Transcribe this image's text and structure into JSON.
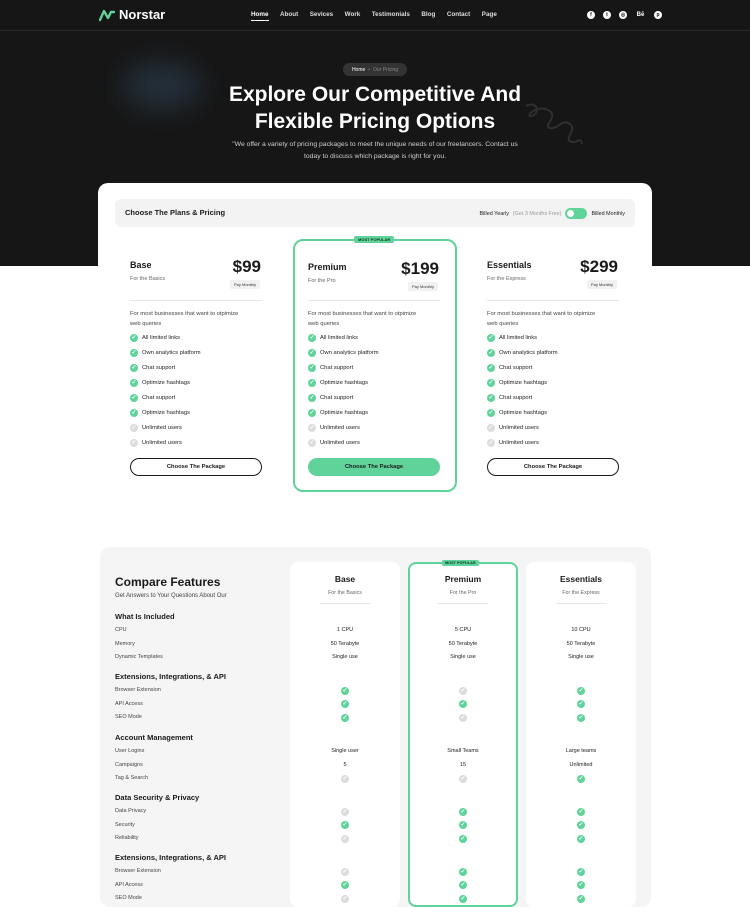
{
  "nav": {
    "brand": "Norstar",
    "items": [
      "Home",
      "About",
      "Sevices",
      "Work",
      "Testimonials",
      "Blog",
      "Contact",
      "Page"
    ],
    "socials": [
      {
        "icon": "facebook-icon",
        "glyph": "f"
      },
      {
        "icon": "twitter-icon",
        "glyph": "t"
      },
      {
        "icon": "dribbble-icon",
        "glyph": "◎"
      },
      {
        "icon": "behance-icon",
        "glyph": "Bē"
      },
      {
        "icon": "pinterest-icon",
        "glyph": "p"
      }
    ]
  },
  "breadcrumb": {
    "home": "Home",
    "current": "Our Pricing"
  },
  "hero": {
    "title_line1": "Explore Our Competitive And",
    "title_line2": "Flexible Pricing Options",
    "subtitle_line1": "\"We offer a variety of pricing packages to meet the unique needs of our freelancers. Contact us",
    "subtitle_line2": "today to discuss which package is right for you."
  },
  "pricing": {
    "bar_title": "Choose The Plans & Pricing",
    "billed_yearly": "Billed Yearly",
    "save_note": "(Get 3 Months Free)",
    "billed_monthly": "Billed Monthly",
    "plans": [
      {
        "name": "Base",
        "for": "For the Basics",
        "price": "$99",
        "billing": "Pay Monthly",
        "popular": false,
        "button": "Choose The Package"
      },
      {
        "name": "Premium",
        "for": "For the Pro",
        "price": "$199",
        "billing": "Pay Monthly",
        "popular": true,
        "badge": "MOST POPULAR",
        "button": "Choose The Package"
      },
      {
        "name": "Essentials",
        "for": "For the Express",
        "price": "$299",
        "billing": "Pay Monthly",
        "popular": false,
        "button": "Choose The Package"
      }
    ],
    "desc_line1": "For most businesses that want to otpimize",
    "desc_line2": "web queries",
    "features": [
      {
        "label": "All limited links",
        "included": true
      },
      {
        "label": "Own analytics platform",
        "included": true
      },
      {
        "label": "Chat support",
        "included": true
      },
      {
        "label": "Optimize hashtags",
        "included": true
      },
      {
        "label": "Chat support",
        "included": true
      },
      {
        "label": "Optimize hashtags",
        "included": true
      },
      {
        "label": "Unlimited users",
        "included": false
      },
      {
        "label": "Unlimited users",
        "included": false
      }
    ]
  },
  "compare": {
    "title": "Compare Features",
    "subtitle": "Get Answers to Your Questions About Our",
    "columns": [
      {
        "name": "Base",
        "for": "For the Basics"
      },
      {
        "name": "Premium",
        "for": "For the Pro",
        "badge": "MOST POPULAR"
      },
      {
        "name": "Essentials",
        "for": "For the Express"
      }
    ],
    "sections": [
      {
        "title": "What Is Included",
        "rows": [
          {
            "label": "CPU",
            "values": [
              "1 CPU",
              "5 CPU",
              "10 CPU"
            ]
          },
          {
            "label": "Memory",
            "values": [
              "50 Terabyte",
              "50 Terabyte",
              "50 Terabyte"
            ]
          },
          {
            "label": "Dynamic Templates",
            "values": [
              "Single use",
              "Single use",
              "Single use"
            ]
          }
        ]
      },
      {
        "title": "Extensions, Integrations, & API",
        "rows": [
          {
            "label": "Browser Extension",
            "values": [
              true,
              false,
              true
            ]
          },
          {
            "label": "API Access",
            "values": [
              true,
              true,
              true
            ]
          },
          {
            "label": "SEO Mode",
            "values": [
              true,
              false,
              true
            ]
          }
        ]
      },
      {
        "title": "Account Management",
        "rows": [
          {
            "label": "User Logins",
            "values": [
              "Single user",
              "Small Teams",
              "Large teams"
            ]
          },
          {
            "label": "Campaigns",
            "values": [
              "5",
              "15",
              "Unlimited"
            ]
          },
          {
            "label": "Tag & Search",
            "values": [
              false,
              false,
              true
            ]
          }
        ]
      },
      {
        "title": "Data Security & Privacy",
        "rows": [
          {
            "label": "Data Privacy",
            "values": [
              false,
              true,
              true
            ]
          },
          {
            "label": "Security",
            "values": [
              true,
              true,
              true
            ]
          },
          {
            "label": "Reliability",
            "values": [
              false,
              true,
              true
            ]
          }
        ]
      },
      {
        "title": "Extensions, Integrations, & API",
        "rows": [
          {
            "label": "Browser Extension",
            "values": [
              false,
              true,
              true
            ]
          },
          {
            "label": "API Access",
            "values": [
              true,
              true,
              true
            ]
          },
          {
            "label": "SEO Mode",
            "values": [
              false,
              true,
              true
            ]
          }
        ]
      }
    ]
  },
  "colors": {
    "accent": "#5fd39a",
    "dark": "#161616"
  }
}
